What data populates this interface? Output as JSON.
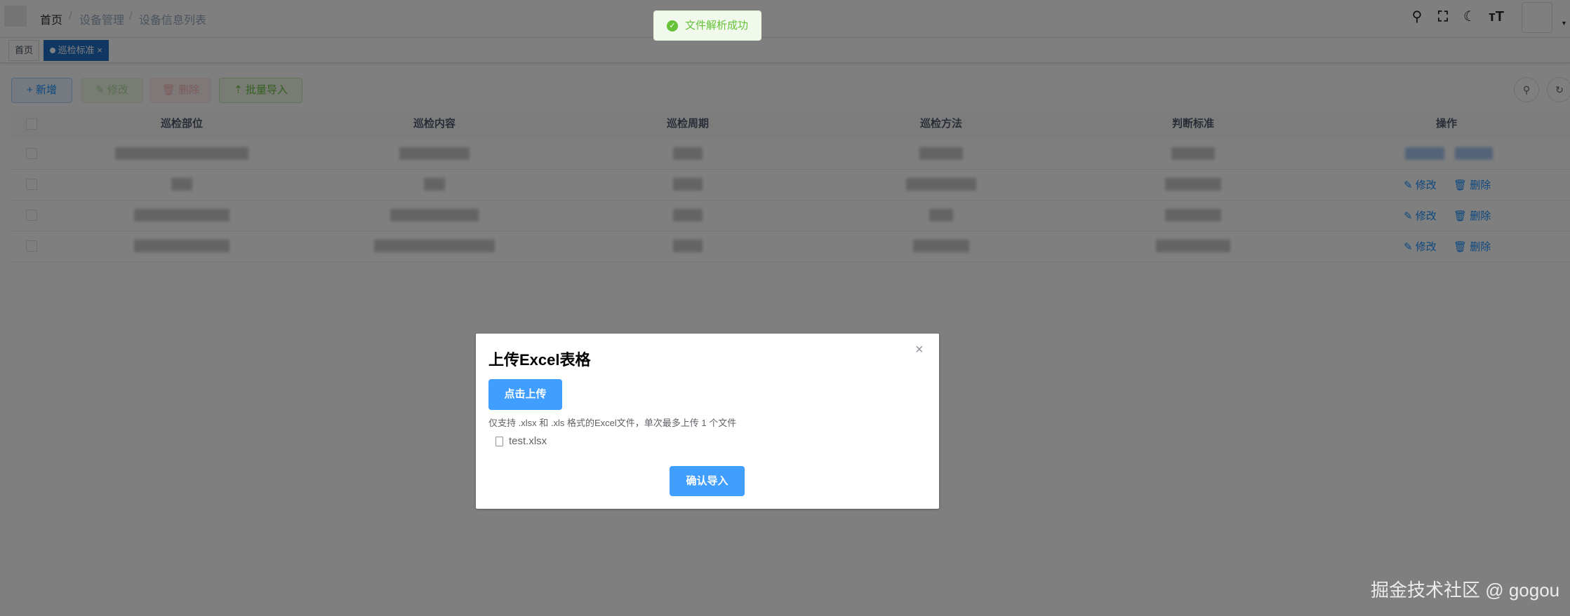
{
  "header": {
    "breadcrumbs": [
      "首页",
      "设备管理",
      "设备信息列表"
    ],
    "icons": [
      "search-icon",
      "fullscreen-icon",
      "moon-icon",
      "font-size-icon"
    ]
  },
  "tags": {
    "home": "首页",
    "active": "巡检标准",
    "close": "×"
  },
  "toolbar": {
    "add": "+ 新增",
    "edit": "修改",
    "delete": "删除",
    "import": "批量导入"
  },
  "table": {
    "columns": [
      "巡检部位",
      "巡检内容",
      "巡检周期",
      "巡检方法",
      "判断标准",
      "操作"
    ],
    "row_ops": {
      "edit": "修改",
      "delete": "删除"
    }
  },
  "toast": {
    "message": "文件解析成功"
  },
  "dialog": {
    "title": "上传Excel表格",
    "upload_button": "点击上传",
    "tip": "仅支持 .xlsx 和 .xls 格式的Excel文件，单次最多上传 1 个文件",
    "file_name": "test.xlsx",
    "confirm_button": "确认导入",
    "close": "×"
  },
  "watermark": "掘金技术社区 @ gogou"
}
